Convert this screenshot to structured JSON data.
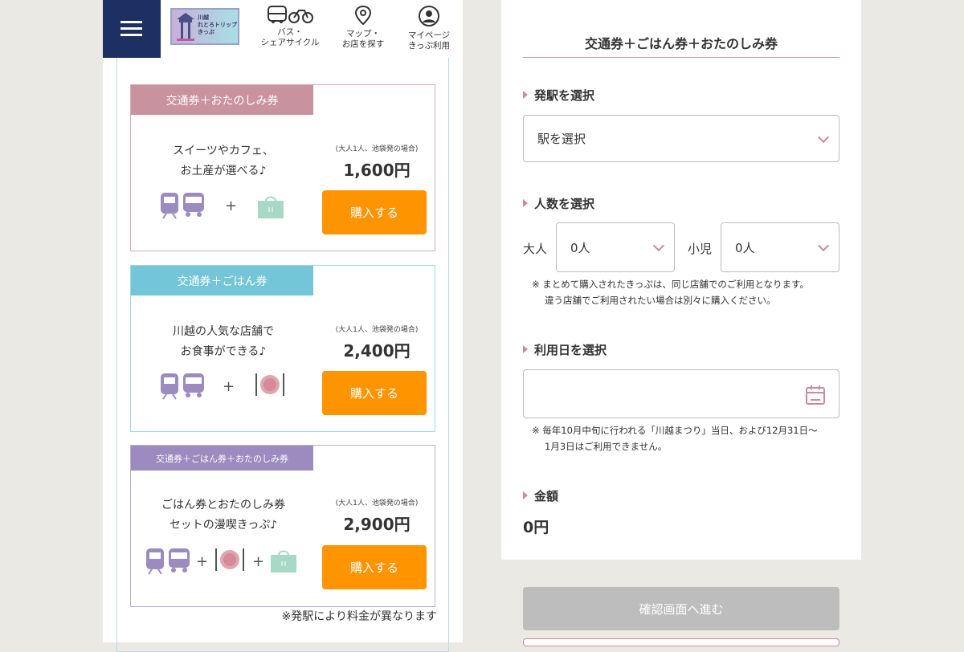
{
  "header": {
    "logo_text_line1": "川越",
    "logo_text_line2": "れとろトリップ",
    "logo_text_line3": "きっぷ",
    "nav": [
      {
        "line1": "バス・",
        "line2": "シェアサイクル",
        "icon": "bus-bicycle-icon"
      },
      {
        "line1": "マップ・",
        "line2": "お店を探す",
        "icon": "map-pin-icon"
      },
      {
        "line1": "マイページ",
        "line2": "きっぷ利用",
        "icon": "user-icon"
      }
    ]
  },
  "cards": [
    {
      "tab": "交通券＋おたのしみ券",
      "tab_color": "#c9929f",
      "desc_line1": "スイーツやカフェ、",
      "desc_line2": "お土産が選べる♪",
      "price_note": "(大人1人、池袋発の場合)",
      "price": "1,600円",
      "buy": "購入する",
      "plus": "+"
    },
    {
      "tab": "交通券＋ごはん券",
      "tab_color": "#72c6d8",
      "desc_line1": "川越の人気な店舗で",
      "desc_line2": "お食事ができる♪",
      "price_note": "(大人1人、池袋発の場合)",
      "price": "2,400円",
      "buy": "購入する",
      "plus": "+"
    },
    {
      "tab": "交通券＋ごはん券＋おたのしみ券",
      "tab_color": "#9b8bbf",
      "desc_line1": "ごはん券とおたのしみ券",
      "desc_line2": "セットの漫喫きっぷ♪",
      "price_note": "(大人1人、池袋発の場合)",
      "price": "2,900円",
      "buy": "購入する",
      "plus": "+"
    }
  ],
  "price_footnote": "※発駅により料金が異なります",
  "form": {
    "title": "交通券＋ごはん券＋おたのしみ券",
    "station_label": "発駅を選択",
    "station_value": "駅を選択",
    "people_label": "人数を選択",
    "adult_label": "大人",
    "adult_value": "0人",
    "child_label": "小児",
    "child_value": "0人",
    "people_note_line1": "※ まとめて購入されたきっぷは、同じ店舗でのご利用となります。",
    "people_note_line2": "違う店舗でご利用されたい場合は別々に購入ください。",
    "date_label": "利用日を選択",
    "date_value": "",
    "date_note_line1": "※ 毎年10月中旬に行われる「川越まつり」当日、および12月31日〜",
    "date_note_line2": "1月3日はご利用できません。",
    "amount_label": "金額",
    "amount_value": "0円",
    "confirm_button": "確認画面へ進む"
  },
  "colors": {
    "brand_navy": "#1c3064",
    "buy_orange": "#fe9400",
    "accent_pink": "#c98ba0",
    "disabled_gray": "#bdbdbd"
  }
}
